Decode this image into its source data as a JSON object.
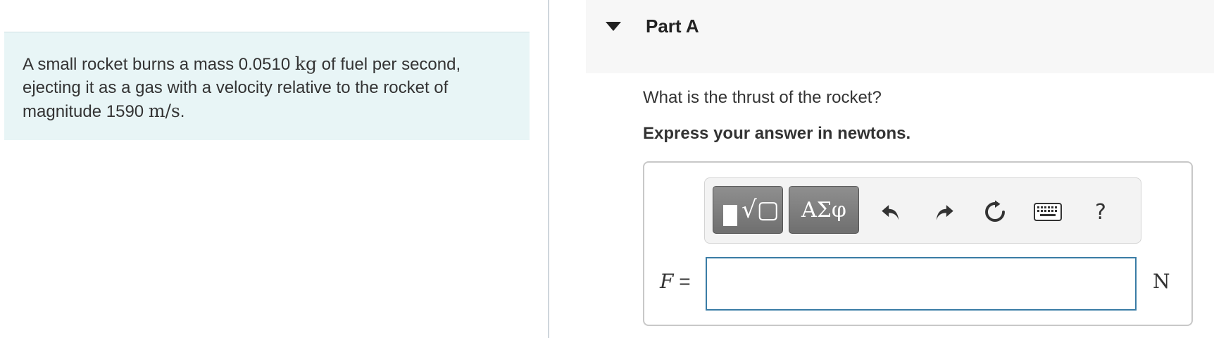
{
  "problem": {
    "text_before_mass": "A small rocket burns a mass 0.0510 ",
    "mass_unit": "kg",
    "text_after_mass": " of fuel per second, ejecting it as a gas with a velocity relative to the rocket of magnitude 1590 ",
    "velocity_unit": "m/s",
    "text_end": "."
  },
  "part": {
    "title": "Part A",
    "question": "What is the thrust of the rocket?",
    "instruction": "Express your answer in newtons."
  },
  "toolbar": {
    "greek_label": "ΑΣφ",
    "radical_glyph": "√▢",
    "help_label": "?"
  },
  "answer": {
    "variable": "F",
    "equals": " =",
    "value": "",
    "unit": "N"
  },
  "colors": {
    "problem_bg": "#e8f5f6",
    "input_border": "#3a7ca5",
    "toolbar_button": "#7f7f7f"
  }
}
